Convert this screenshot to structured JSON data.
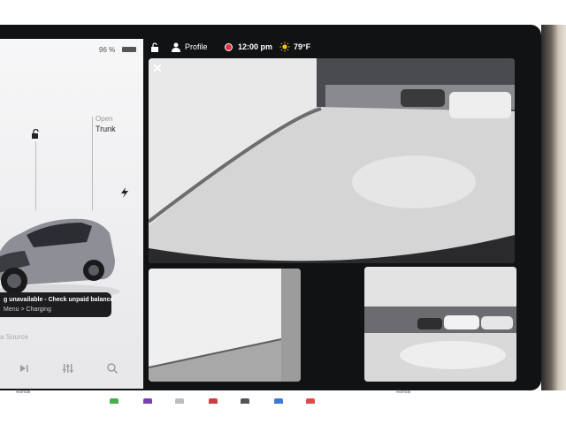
{
  "vehicle": {
    "battery_percent": "96 %",
    "trunk": {
      "state_label": "Open",
      "name": "Trunk"
    }
  },
  "alert": {
    "title": "g unavailable - Check unpaid balance",
    "subtitle": "Menu > Charging"
  },
  "media": {
    "source_label": "a Source",
    "controls": [
      "next-track-icon",
      "equalizer-icon",
      "search-icon"
    ]
  },
  "status_bar": {
    "profile_label": "Profile",
    "time": "12:00 pm",
    "temperature": "79°F"
  },
  "camera": {
    "views": [
      "rear",
      "left-repeater",
      "right-repeater"
    ]
  },
  "footer": {
    "left_mode_label": "Manual",
    "right_mode_label": "Manual"
  },
  "colors": {
    "record_dot": "#e0313c",
    "screen_bg": "#111214",
    "alert_bg": "#1d1d1f",
    "sun": "#f5c518"
  }
}
